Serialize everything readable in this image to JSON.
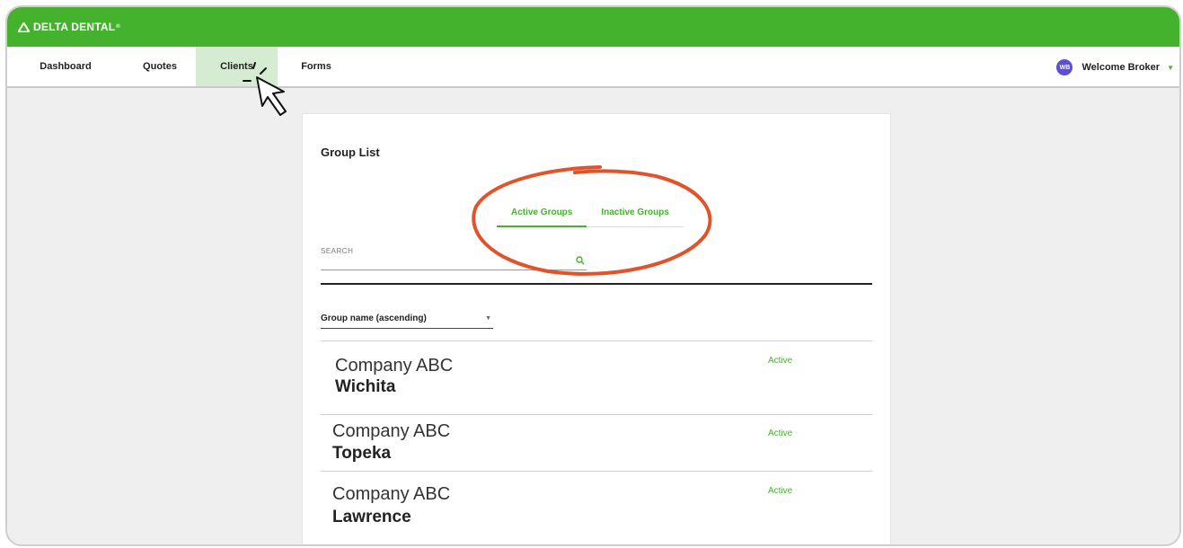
{
  "brand": {
    "name": "DELTA DENTAL",
    "color": "#45b22e"
  },
  "nav": {
    "items": [
      {
        "label": "Dashboard"
      },
      {
        "label": "Quotes"
      },
      {
        "label": "Clients",
        "active": true
      },
      {
        "label": "Forms"
      }
    ],
    "user": {
      "initials": "WB",
      "label": "Welcome Broker"
    }
  },
  "card": {
    "title": "Group List",
    "tabs": [
      {
        "label": "Active Groups",
        "active": true
      },
      {
        "label": "Inactive Groups",
        "active": false
      }
    ],
    "search": {
      "label": "SEARCH",
      "value": ""
    },
    "sort": {
      "selected": "Group name (ascending)"
    },
    "groups": [
      {
        "company": "Company ABC",
        "city": "Wichita",
        "status": "Active"
      },
      {
        "company": "Company ABC",
        "city": "Topeka",
        "status": "Active"
      },
      {
        "company": "Company ABC",
        "city": "Lawrence",
        "status": "Active"
      }
    ]
  },
  "colors": {
    "accent": "#45b22e",
    "annotation": "#e0532b",
    "avatar": "#5a4fd6"
  }
}
